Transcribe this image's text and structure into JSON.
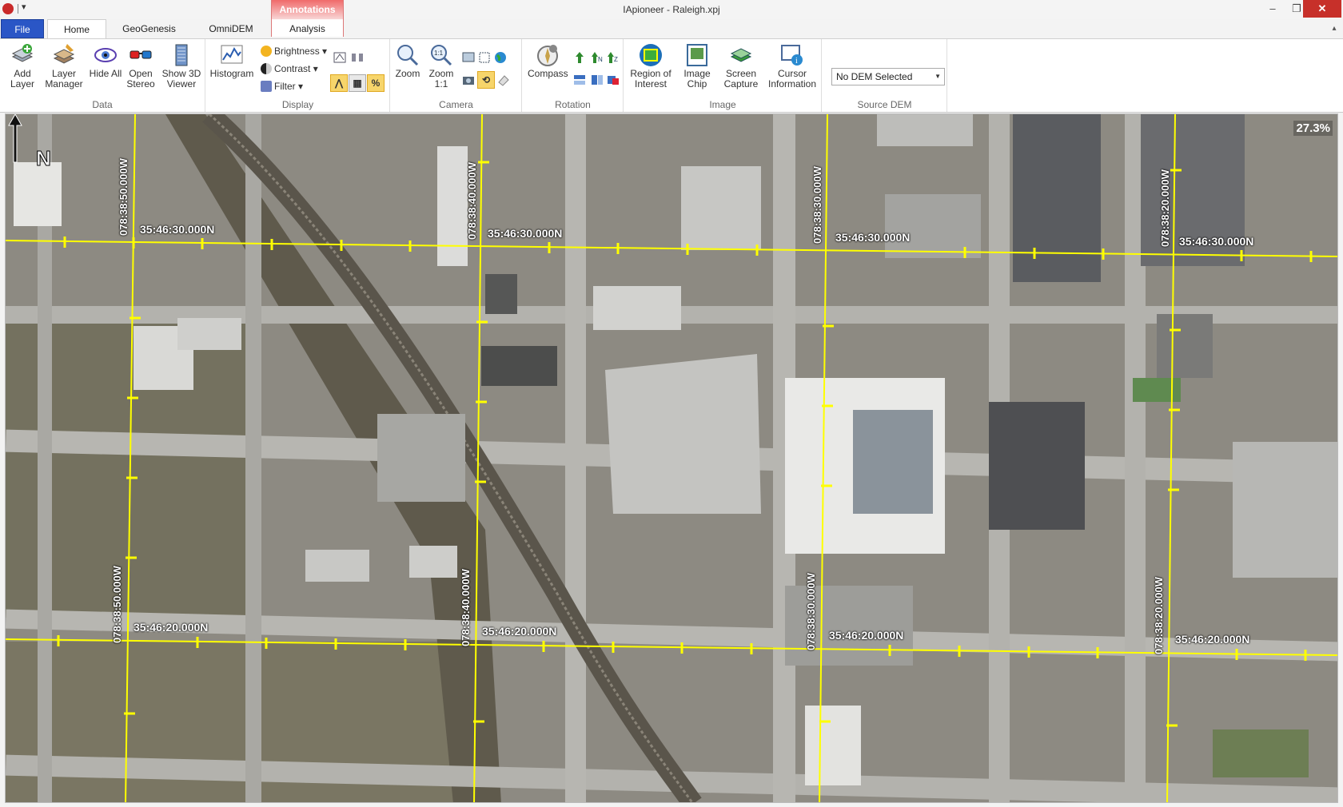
{
  "app": {
    "window_title": "IApioneer - Raleigh.xpj",
    "contextual_tab_group": "Annotations"
  },
  "tabs": {
    "file": "File",
    "home": "Home",
    "geogenesis": "GeoGenesis",
    "omnidem": "OmniDEM",
    "analysis": "Analysis"
  },
  "ribbon": {
    "data": {
      "label": "Data",
      "add_layer": "Add Layer",
      "layer_manager": "Layer Manager",
      "hide_all": "Hide All",
      "open_stereo": "Open Stereo",
      "show_3d_viewer": "Show 3D Viewer"
    },
    "display": {
      "label": "Display",
      "histogram": "Histogram",
      "brightness": "Brightness",
      "contrast": "Contrast",
      "filter": "Filter",
      "percent_toggle": "%"
    },
    "camera": {
      "label": "Camera",
      "zoom": "Zoom",
      "zoom_1_1": "Zoom 1:1"
    },
    "rotation": {
      "label": "Rotation",
      "compass": "Compass"
    },
    "image": {
      "label": "Image",
      "region_of_interest": "Region of Interest",
      "image_chip": "Image Chip",
      "screen_capture": "Screen Capture",
      "cursor_information": "Cursor Information"
    },
    "source_dem": {
      "label": "Source DEM",
      "selected": "No DEM Selected"
    }
  },
  "map": {
    "zoom_level": "27.3%",
    "north_label": "N",
    "latitude_labels": [
      "35:46:30.000N",
      "35:46:20.000N"
    ],
    "longitude_labels": [
      "078:38:50.000W",
      "078:38:40.000W",
      "078:38:30.000W",
      "078:38:20.000W"
    ],
    "grid_color": "#ffff00"
  }
}
